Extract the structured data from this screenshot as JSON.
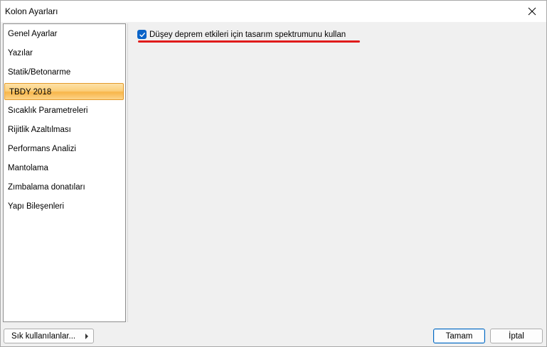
{
  "window": {
    "title": "Kolon Ayarları"
  },
  "sidebar": {
    "items": [
      {
        "label": "Genel Ayarlar",
        "selected": false
      },
      {
        "label": "Yazılar",
        "selected": false
      },
      {
        "label": "Statik/Betonarme",
        "selected": false
      },
      {
        "label": "TBDY 2018",
        "selected": true
      },
      {
        "label": "Sıcaklık Parametreleri",
        "selected": false
      },
      {
        "label": "Rijitlik Azaltılması",
        "selected": false
      },
      {
        "label": "Performans Analizi",
        "selected": false
      },
      {
        "label": "Mantolama",
        "selected": false
      },
      {
        "label": "Zımbalama donatıları",
        "selected": false
      },
      {
        "label": "Yapı Bileşenleri",
        "selected": false
      }
    ]
  },
  "content": {
    "vertical_spectrum_checkbox": {
      "label": "Düşey deprem etkileri için tasarım spektrumunu kullan",
      "checked": true
    }
  },
  "footer": {
    "frequently_used_label": "Sık kullanılanlar...",
    "ok_label": "Tamam",
    "cancel_label": "İptal"
  },
  "colors": {
    "checkbox_accent": "#0a64c8",
    "highlight_underline": "#e01b1b",
    "selected_item": "#f8b64a"
  }
}
